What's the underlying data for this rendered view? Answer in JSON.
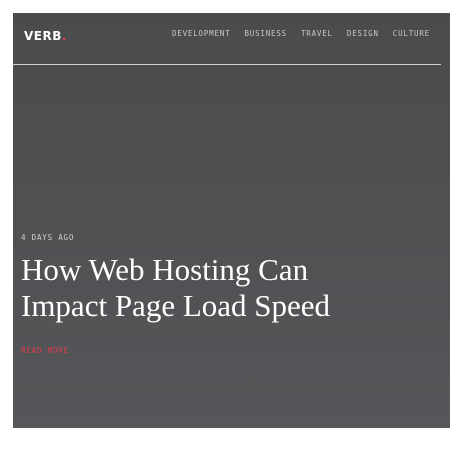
{
  "brand": {
    "logo_text": "VERB",
    "logo_dot": ".",
    "accent_color": "#e23b4a"
  },
  "nav": {
    "items": [
      {
        "label": "DEVELOPMENT"
      },
      {
        "label": "BUSINESS"
      },
      {
        "label": "TRAVEL"
      },
      {
        "label": "DESIGN"
      },
      {
        "label": "CULTURE"
      }
    ]
  },
  "hero": {
    "timestamp": "4 DAYS AGO",
    "headline": "How Web Hosting Can Impact Page Load Speed",
    "read_more": "READ MORE"
  }
}
